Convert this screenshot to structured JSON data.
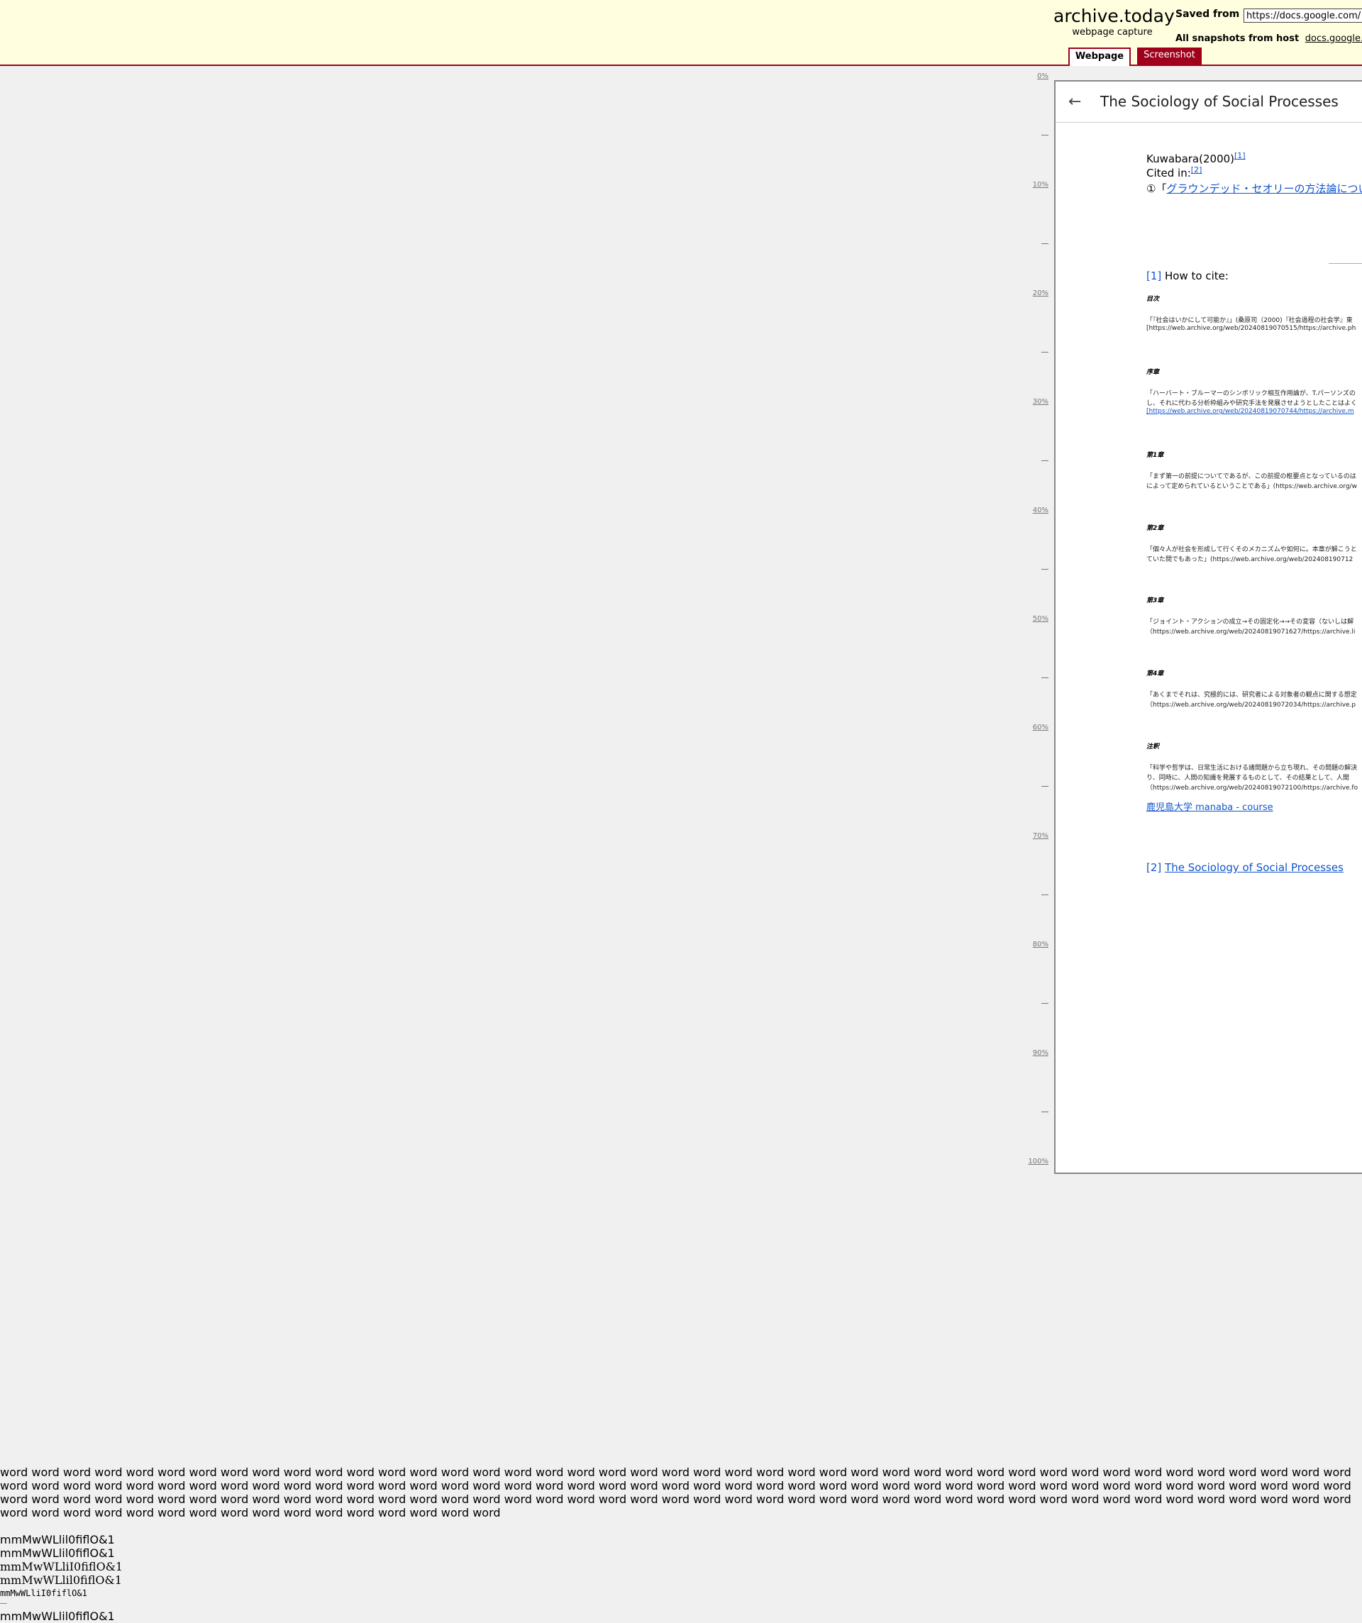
{
  "header": {
    "brand_name": "archive.today",
    "brand_sub": "webpage capture",
    "saved_from_label": "Saved from",
    "saved_url": "https://docs.google.com/",
    "snapshots_label": "All snapshots",
    "snapshots_from": "from host",
    "snapshots_host": "docs.google.com",
    "tabs": [
      "Webpage",
      "Screenshot"
    ]
  },
  "ruler": [
    "0%",
    "10%",
    "20%",
    "30%",
    "40%",
    "50%",
    "60%",
    "70%",
    "80%",
    "90%",
    "100%"
  ],
  "doc": {
    "title": "The Sociology of Social Processes",
    "author_line": "Kuwabara(2000)",
    "ref1": "[1]",
    "cited_in": "Cited in:",
    "ref2": "[2]",
    "item1_prefix": "①「",
    "item1_link": "グラウンデッド・セオリーの方法論につい",
    "fn1_ref": "[1]",
    "fn1_text": " How to cite:",
    "sections": [
      {
        "head": "目次",
        "lines": [
          "「『社会はいかにして可能か』」(桑原司（2000)『社会過程の社会学』東",
          "[https://web.archive.org/web/20240819070515/https://archive.ph"
        ]
      },
      {
        "head": "序章",
        "lines": [
          "「ハーバート・ブルーマーのシンボリック相互作用論が、T.パーソンズの",
          "し、それに代わる分析枠組みや研究手法を発展させようとしたことはよく",
          "[https://web.archive.org/web/20240819070744/https://archive.m"
        ]
      },
      {
        "head": "第1章",
        "lines": [
          "「まず第一の前提についてであるが、この前提の枢要点となっているのは",
          "によって定められているということである」(https://web.archive.org/w"
        ]
      },
      {
        "head": "第2章",
        "lines": [
          "「個々人が社会を形成して行くそのメカニズムや如何に。本章が解こうと",
          "ていた問でもあった」(https://web.archive.org/web/202408190712"
        ]
      },
      {
        "head": "第3章",
        "lines": [
          "「ジョイント・アクションの成立→その固定化→→その変容（ないしは解",
          "（https://web.archive.org/web/20240819071627/https://archive.li"
        ]
      },
      {
        "head": "第4章",
        "lines": [
          "「あくまでそれは、究極的には、研究者による対象者の観点に関する想定",
          "（https://web.archive.org/web/20240819072034/https://archive.p"
        ]
      },
      {
        "head": "注釈",
        "lines": [
          "「科学や哲学は、日常生活における諸問題から立ち現れ、その問題の解決",
          "り、同時に、人間の知識を発展するものとして、その結果として、人間",
          "（https://web.archive.org/web/20240819072100/https://archive.fo"
        ]
      }
    ],
    "manaba_link": "鹿児島大学 manaba - course",
    "fn2_ref": "[2]",
    "fn2_link": "The Sociology of Social Processes"
  },
  "bottom": {
    "words": "word word word word word word word word word word word word word word word word word word word word word word word word word word word word word word word word word word word word word word word word word word word word word word word word word word word word word word word word word word word word word word word word word word word word word word word word word word word word word word word word word word word word word word word word word word word word word word word word word word word word word word word word word word word word word word word word word word word word word word word word word word word word word word word word word word word word word word word word word word word word word word word word word",
    "font_samples": [
      "mmMwWLlil0fiflO&1",
      "mmMwWLlil0fiflO&1",
      "mmMwWLliI0fiflO&1",
      "mmMwWLlil0fiflO&1",
      "mmMwWLliI0fiflO&1",
      "mmMwWLlil0fiflO&1"
    ]
  }
}
